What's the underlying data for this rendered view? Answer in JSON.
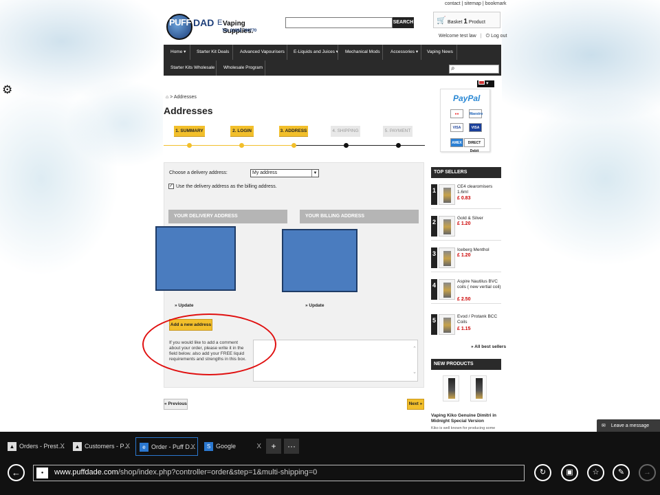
{
  "top_links": [
    "contact",
    "sitemap",
    "bookmark"
  ],
  "logo": {
    "puff": "PUFF",
    "dad": "DAD",
    "e": "E",
    "vaping": "Vaping Supplies.",
    "tel": "Tel: 01992 700770"
  },
  "header": {
    "search_button": "SEARCH",
    "basket_label": "Basket",
    "basket_count": "1",
    "basket_unit": "Product",
    "welcome": "Welcome test law",
    "logout": "Log out"
  },
  "nav": {
    "row1": [
      "Home",
      "Starter Kit Deals",
      "Advanced Vapourisers",
      "E-Liquids and Juices",
      "Mechanical Mods",
      "Accessories",
      "Vaping News"
    ],
    "row2": [
      "Starter Kits Wholesale",
      "Wholesale Program"
    ]
  },
  "breadcrumb": {
    "current": "Addresses"
  },
  "page_title": "Addresses",
  "steps": [
    "1. SUMMARY",
    "2. LOGIN",
    "3. ADDRESS",
    "4. SHIPPING",
    "5. PAYMENT"
  ],
  "form": {
    "choose_label": "Choose a delivery address:",
    "selected_address": "My address",
    "same_billing": "Use the delivery address as the billing address.",
    "delivery_head": "YOUR DELIVERY ADDRESS",
    "billing_head": "YOUR BILLING ADDRESS",
    "update_label": "» Update",
    "add_address": "Add a new address",
    "comment_hint": "If you would like to add a comment about your order, please write it in the field below. also add your FREE liquid requirements and strengths in this box.",
    "previous": "« Previous",
    "next": "Next »"
  },
  "sidebar": {
    "paypal_pay": "Pay",
    "paypal_pal": "Pal",
    "cards": [
      "Maestro",
      "VISA",
      "VISA",
      "AMEX",
      "DIRECT Debit"
    ],
    "top_sellers_head": "TOP SELLERS",
    "sellers": [
      {
        "num": "1",
        "name": "CE4 clearomisers 1.6ml",
        "price": "£ 0.83"
      },
      {
        "num": "2",
        "name": "Gold & Silver",
        "price": "£ 1.20"
      },
      {
        "num": "3",
        "name": "Iceberg Menthol",
        "price": "£ 1.20"
      },
      {
        "num": "4",
        "name": "Aspire Nautilus BVC coils ( new vertial coil)",
        "price": "£ 2.50"
      },
      {
        "num": "5",
        "name": "Evod / Protank BCC Coils",
        "price": "£ 1.15"
      }
    ],
    "all_best": "» All best sellers",
    "new_products_head": "NEW PRODUCTS",
    "np_title": "Vaping Kiko Genuine Dimitri in Midnight Special Version",
    "np_desc": "Kiko is well known for producing some"
  },
  "chat": {
    "leave_message": "Leave a message"
  },
  "browser": {
    "tabs": [
      {
        "title": "Orders - Prest…",
        "icon": "prestashop-icon"
      },
      {
        "title": "Customers - P…",
        "icon": "prestashop-icon"
      },
      {
        "title": "Order - Puff D…",
        "icon": "ie-icon"
      },
      {
        "title": "Google",
        "icon": "google-icon"
      }
    ],
    "url_host": "www.puffdade.com",
    "url_path": "/shop/index.php?controller=order&step=1&multi-shipping=0"
  }
}
